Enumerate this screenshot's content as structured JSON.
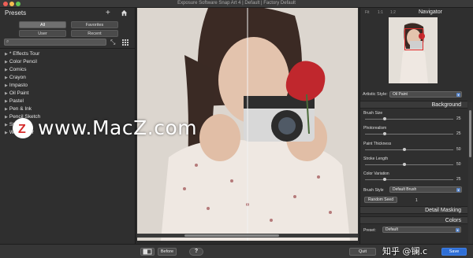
{
  "window": {
    "title": "Exposure Software Snap Art 4 | Default | Factory Default"
  },
  "left_panel": {
    "title": "Presets",
    "filters": [
      "All",
      "Favorites",
      "User",
      "Recent"
    ],
    "presets": [
      "* Effects Tour",
      "Color Pencil",
      "Comics",
      "Crayon",
      "Impasto",
      "Oil Paint",
      "Pastel",
      "Pen & Ink",
      "Pencil Sketch",
      "Stylize",
      "Watercolor"
    ]
  },
  "navigator": {
    "title": "Navigator",
    "zoom_options": [
      "Fit",
      "1:1",
      "1:2"
    ]
  },
  "artistic_style": {
    "label": "Artistic Style:",
    "value": "Oil Paint"
  },
  "background": {
    "title": "Background",
    "sliders": [
      {
        "label": "Brush Size",
        "value": "25",
        "level": 0.22
      },
      {
        "label": "Photorealism",
        "value": "25",
        "level": 0.22
      },
      {
        "label": "Paint Thickness",
        "value": "50",
        "level": 0.45
      },
      {
        "label": "Stroke Length",
        "value": "50",
        "level": 0.45
      },
      {
        "label": "Color Variation",
        "value": "25",
        "level": 0.22
      }
    ],
    "brush_style_label": "Brush Style",
    "brush_style_value": "Default Brush",
    "random_seed_label": "Random Seed",
    "random_seed_value": "1"
  },
  "detail_masking": {
    "title": "Detail Masking"
  },
  "colors": {
    "title": "Colors",
    "preset_label": "Preset:",
    "preset_value": "Default"
  },
  "bottom_bar": {
    "before_label": "Before",
    "quit_label": "Quit",
    "save_label": "Save"
  },
  "watermark": {
    "site_text": "www.MacZ.com",
    "zh_text": "知乎 @镧.c"
  },
  "colors_palette": {
    "accent": "#2f6fd6",
    "panel": "#2f2f2f",
    "section": "#3a3a3a"
  },
  "icons": [
    "plus-icon",
    "home-icon",
    "search-icon",
    "collapse-icon",
    "grid-icon",
    "layout-icon",
    "help-icon",
    "zoom-out-icon",
    "zoom-in-icon"
  ]
}
